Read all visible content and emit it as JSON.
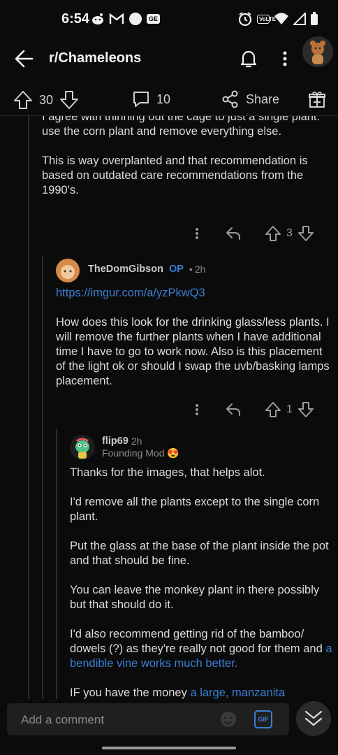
{
  "status_bar": {
    "time": "6:54",
    "notif_badge": "GE",
    "network_label": "VoLTE"
  },
  "app_bar": {
    "title": "r/Chameleons"
  },
  "post_actions": {
    "score": "30",
    "comments": "10",
    "share_label": "Share"
  },
  "comments": [
    {
      "paragraphs": [
        "I agree with thinning out the cage to just a single plant.\nuse the corn plant and remove everything else.",
        "This is way overplanted and that recommendation is based on outdated care recommendations from the 1990's."
      ],
      "score": "3"
    },
    {
      "author": "TheDomGibson",
      "op_label": "OP",
      "time": "2h",
      "link": "https://imgur.com/a/yzPkwQ3",
      "paragraphs": [
        "How does this look for the drinking glass/less plants. I will remove the further plants when I have additional time I have to go to work now. Also is this placement of the light ok or should I swap the uvb/basking lamps placement."
      ],
      "score": "1"
    },
    {
      "author": "flip69",
      "time": "2h",
      "flair": "Founding Mod 😍",
      "paragraphs": [
        "Thanks for the images, that helps alot.",
        "I'd remove all the plants except to the single corn plant.",
        "Put the glass at the base of the plant inside the pot and that should be fine.",
        "You can leave the monkey plant in there possibly but that should do it."
      ],
      "p5_text": "I'd also recommend getting rid of the bamboo/ dowels (?) as they're really not good for them and ",
      "p5_link": "a bendible vine works much better.",
      "p6_text": "IF you have the money ",
      "p6_link": "a large, manzanita"
    }
  ],
  "composer": {
    "placeholder": "Add a comment",
    "gif_label": "GIF"
  },
  "colors": {
    "background": "#0b0b0b",
    "link": "#3b7fd6",
    "text": "#dcdcdc",
    "muted": "#8c8c8c"
  }
}
